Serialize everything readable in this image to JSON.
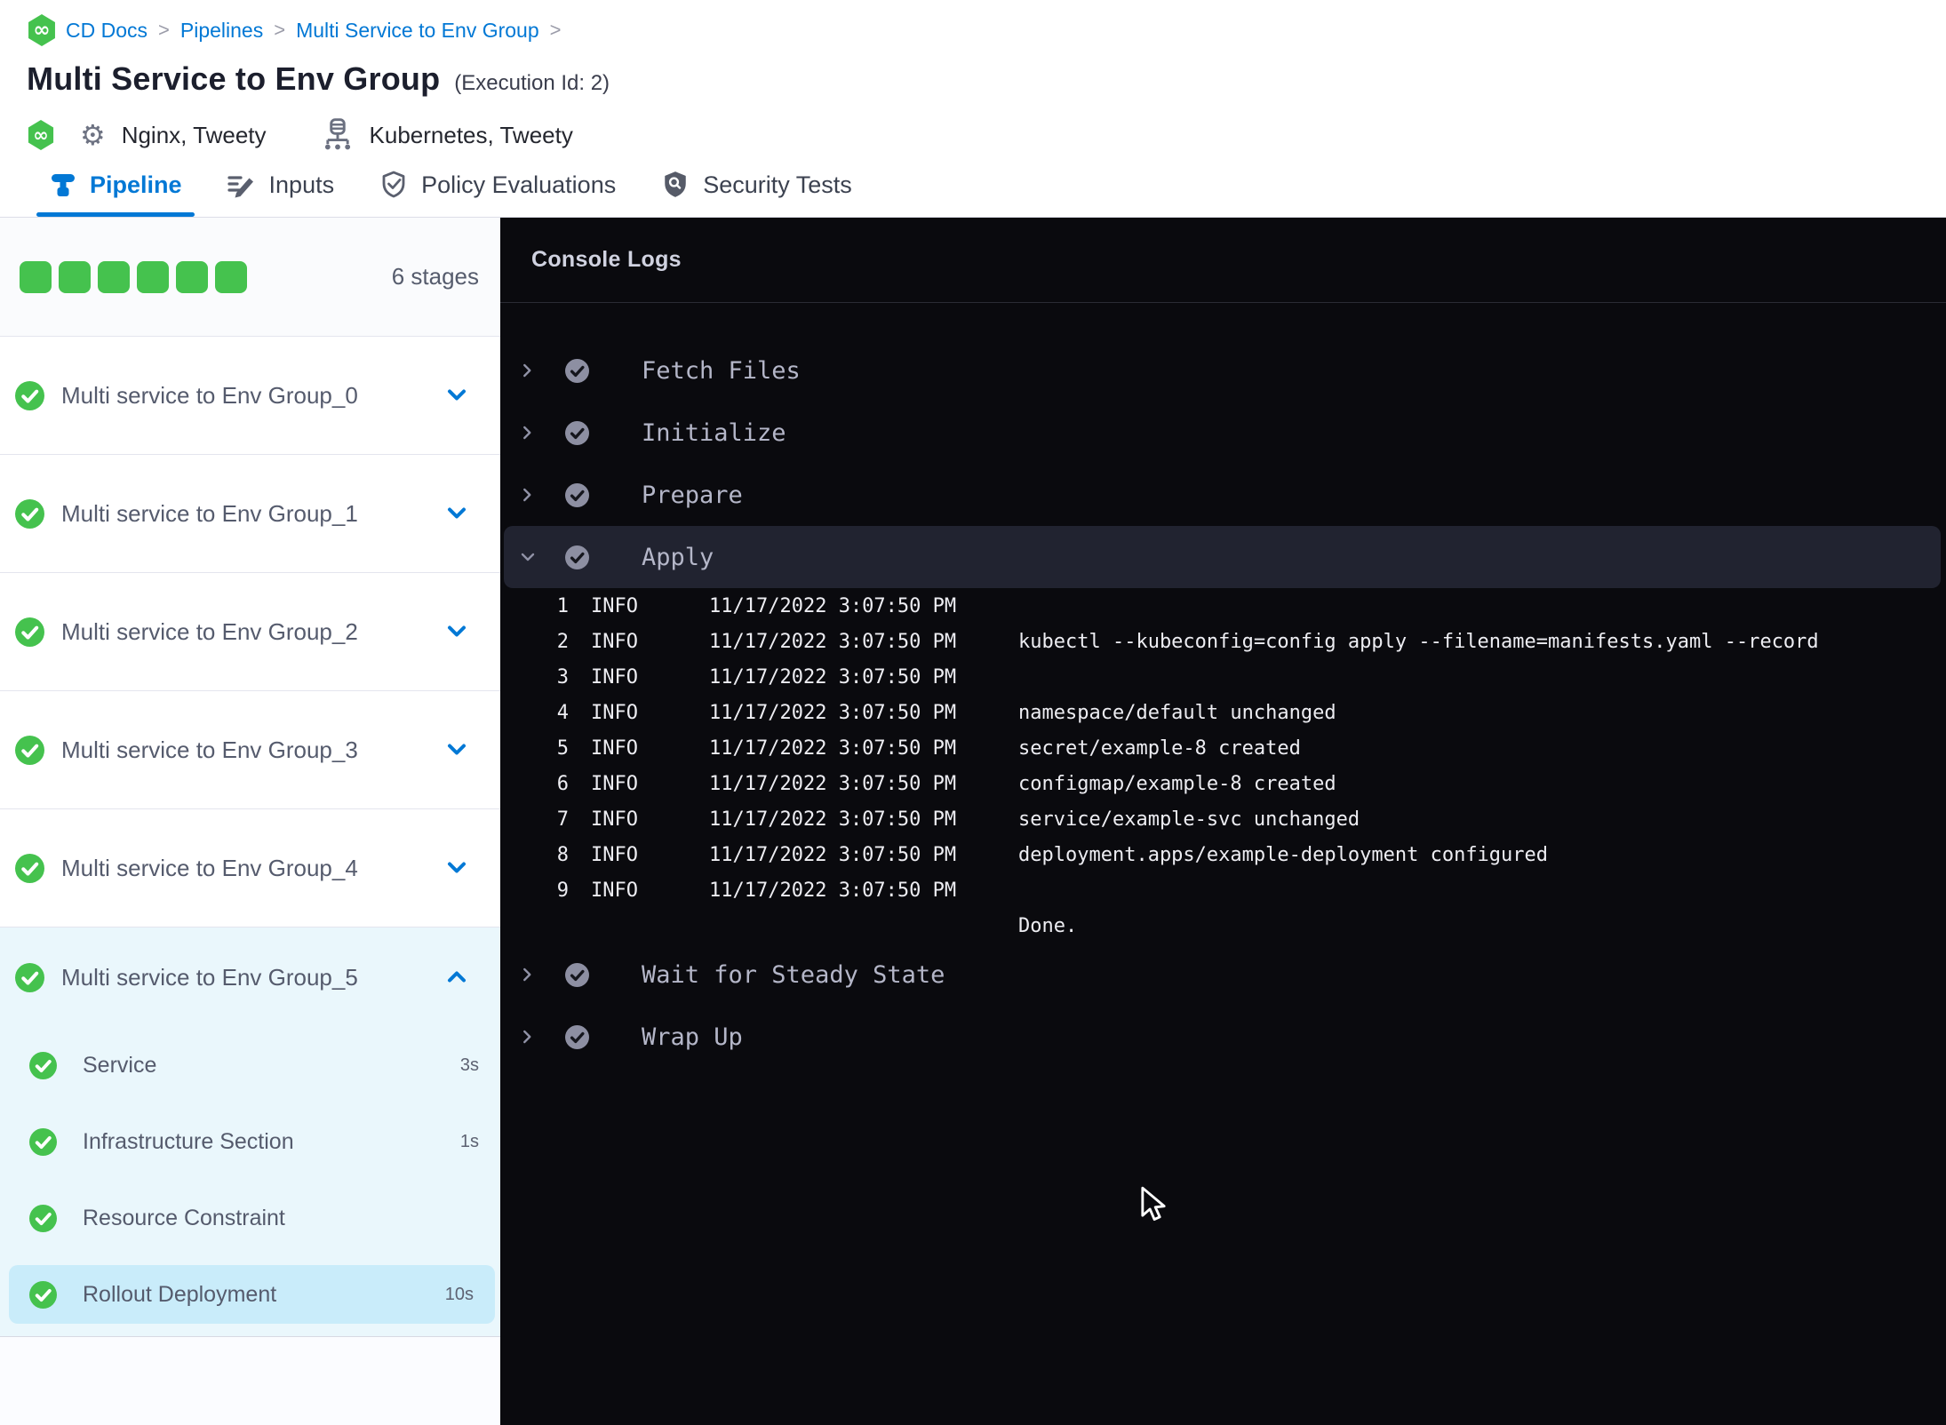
{
  "breadcrumb": {
    "separator": ">",
    "items": [
      "CD Docs",
      "Pipelines",
      "Multi Service to Env Group"
    ]
  },
  "header": {
    "title": "Multi Service to Env Group",
    "execution_id": "(Execution Id: 2)",
    "services_label": "Nginx, Tweety",
    "environments_label": "Kubernetes, Tweety"
  },
  "tabs": [
    {
      "label": "Pipeline",
      "active": true
    },
    {
      "label": "Inputs",
      "active": false
    },
    {
      "label": "Policy Evaluations",
      "active": false
    },
    {
      "label": "Security Tests",
      "active": false
    }
  ],
  "sidebar": {
    "stage_count_label": "6 stages",
    "stages": [
      {
        "label": "Multi service to Env Group_0",
        "status": "success"
      },
      {
        "label": "Multi service to Env Group_1",
        "status": "success"
      },
      {
        "label": "Multi service to Env Group_2",
        "status": "success"
      },
      {
        "label": "Multi service to Env Group_3",
        "status": "success"
      },
      {
        "label": "Multi service to Env Group_4",
        "status": "success"
      }
    ],
    "expanded_stage": {
      "label": "Multi service to Env Group_5",
      "status": "success",
      "steps": [
        {
          "label": "Service",
          "duration": "3s"
        },
        {
          "label": "Infrastructure Section",
          "duration": "1s"
        },
        {
          "label": "Resource Constraint",
          "duration": ""
        },
        {
          "label": "Rollout Deployment",
          "duration": "10s",
          "selected": true
        }
      ]
    }
  },
  "console": {
    "title": "Console Logs",
    "steps_before": [
      "Fetch Files",
      "Initialize",
      "Prepare"
    ],
    "expanded_step": "Apply",
    "logs": [
      {
        "n": "1",
        "level": "INFO",
        "time": "11/17/2022 3:07:50 PM",
        "msg": ""
      },
      {
        "n": "2",
        "level": "INFO",
        "time": "11/17/2022 3:07:50 PM",
        "msg": "kubectl --kubeconfig=config apply --filename=manifests.yaml --record"
      },
      {
        "n": "3",
        "level": "INFO",
        "time": "11/17/2022 3:07:50 PM",
        "msg": ""
      },
      {
        "n": "4",
        "level": "INFO",
        "time": "11/17/2022 3:07:50 PM",
        "msg": "namespace/default unchanged"
      },
      {
        "n": "5",
        "level": "INFO",
        "time": "11/17/2022 3:07:50 PM",
        "msg": "secret/example-8 created"
      },
      {
        "n": "6",
        "level": "INFO",
        "time": "11/17/2022 3:07:50 PM",
        "msg": "configmap/example-8 created"
      },
      {
        "n": "7",
        "level": "INFO",
        "time": "11/17/2022 3:07:50 PM",
        "msg": "service/example-svc unchanged"
      },
      {
        "n": "8",
        "level": "INFO",
        "time": "11/17/2022 3:07:50 PM",
        "msg": "deployment.apps/example-deployment configured"
      },
      {
        "n": "9",
        "level": "INFO",
        "time": "11/17/2022 3:07:50 PM",
        "msg": ""
      }
    ],
    "done": "Done.",
    "steps_after": [
      "Wait for Steady State",
      "Wrap Up"
    ]
  },
  "colors": {
    "accent_blue": "#0278d5",
    "success_green": "#45c24e",
    "console_bg": "#0a0a0e",
    "apply_row_bg": "#212330",
    "expanded_stage_bg": "#eaf7fc",
    "selected_step_bg": "#c9ecfa"
  }
}
